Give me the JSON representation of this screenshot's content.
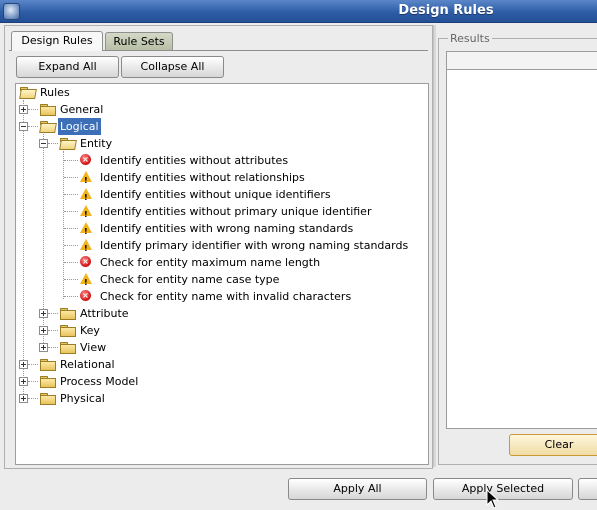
{
  "window": {
    "title": "Design Rules"
  },
  "tabs": [
    {
      "label": "Design Rules",
      "active": true
    },
    {
      "label": "Rule Sets",
      "active": false
    }
  ],
  "toolbar": {
    "expand_all": "Expand All",
    "collapse_all": "Collapse All"
  },
  "tree": {
    "root": "Rules",
    "general": "General",
    "logical": "Logical",
    "entity": "Entity",
    "rules": [
      {
        "icon": "error",
        "label": "Identify entities without attributes"
      },
      {
        "icon": "warning",
        "label": "Identify entities without relationships"
      },
      {
        "icon": "warning",
        "label": "Identify entities without unique identifiers"
      },
      {
        "icon": "warning",
        "label": "Identify entities without primary unique identifier"
      },
      {
        "icon": "warning",
        "label": "Identify entities with wrong naming standards"
      },
      {
        "icon": "warning",
        "label": "Identify primary identifier with wrong naming standards"
      },
      {
        "icon": "error",
        "label": "Check for entity maximum name length"
      },
      {
        "icon": "warning",
        "label": "Check for entity name case type"
      },
      {
        "icon": "error",
        "label": "Check for entity name with invalid characters"
      }
    ],
    "attribute": "Attribute",
    "key": "Key",
    "view": "View",
    "relational": "Relational",
    "process_model": "Process Model",
    "physical": "Physical"
  },
  "results": {
    "legend": "Results",
    "clear": "Clear"
  },
  "footer": {
    "apply_all": "Apply All",
    "apply_selected": "Apply Selected"
  }
}
